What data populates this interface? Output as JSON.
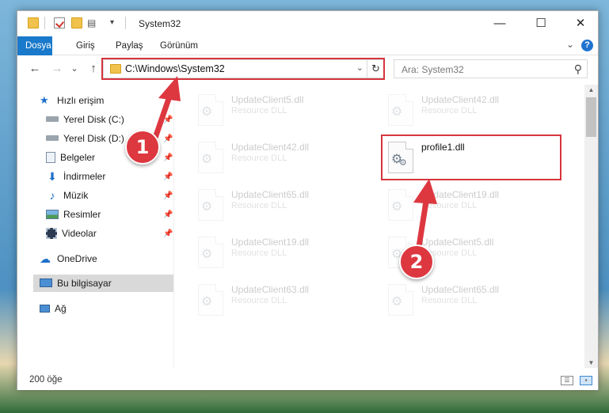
{
  "window": {
    "title": "System32"
  },
  "title_controls": {
    "minimize": "—",
    "maximize": "☐",
    "close": "✕"
  },
  "ribbon": {
    "tabs": [
      "Dosya",
      "Giriş",
      "Paylaş",
      "Görünüm"
    ],
    "active_tab": "Dosya",
    "help": "?"
  },
  "navigation": {
    "back": "←",
    "forward": "→",
    "recent": "⌄",
    "up": "↑",
    "address": "C:\\Windows\\System32",
    "refresh": "↻",
    "search_placeholder": "Ara: System32"
  },
  "sidebar": {
    "items": [
      {
        "label": "Hızlı erişim",
        "icon": "star-icon",
        "pinned": false
      },
      {
        "label": "Yerel Disk (C:)",
        "icon": "drive-icon",
        "pinned": true
      },
      {
        "label": "Yerel Disk (D:)",
        "icon": "drive-icon",
        "pinned": true
      },
      {
        "label": "Belgeler",
        "icon": "documents-icon",
        "pinned": true
      },
      {
        "label": "İndirmeler",
        "icon": "download-icon",
        "pinned": true
      },
      {
        "label": "Müzik",
        "icon": "music-icon",
        "pinned": true
      },
      {
        "label": "Resimler",
        "icon": "pictures-icon",
        "pinned": true
      },
      {
        "label": "Videolar",
        "icon": "videos-icon",
        "pinned": true
      },
      {
        "label": "OneDrive",
        "icon": "cloud-icon",
        "pinned": false
      },
      {
        "label": "Bu bilgisayar",
        "icon": "computer-icon",
        "pinned": false,
        "selected": true
      },
      {
        "label": "Ağ",
        "icon": "network-icon",
        "pinned": false
      }
    ]
  },
  "files": [
    {
      "name": "UpdateClient5.dll",
      "type": "Resource DLL",
      "faded": true
    },
    {
      "name": "UpdateClient42.dll",
      "type": "Resource DLL",
      "faded": true
    },
    {
      "name": "UpdateClient42.dll",
      "type": "Resource DLL",
      "faded": true
    },
    {
      "name": "profile1.dll",
      "type": "",
      "faded": false,
      "highlighted": true
    },
    {
      "name": "UpdateClient65.dll",
      "type": "Resource DLL",
      "faded": true
    },
    {
      "name": "UpdateClient19.dll",
      "type": "Resource DLL",
      "faded": true
    },
    {
      "name": "UpdateClient19.dll",
      "type": "Resource DLL",
      "faded": true
    },
    {
      "name": "UpdateClient5.dll",
      "type": "Resource DLL",
      "faded": true
    },
    {
      "name": "UpdateClient63.dll",
      "type": "Resource DLL",
      "faded": true
    },
    {
      "name": "UpdateClient65.dll",
      "type": "Resource DLL",
      "faded": true
    }
  ],
  "status": {
    "item_count": "200 öğe"
  },
  "annotations": {
    "step1": "1",
    "step2": "2",
    "color": "#dd3740"
  }
}
